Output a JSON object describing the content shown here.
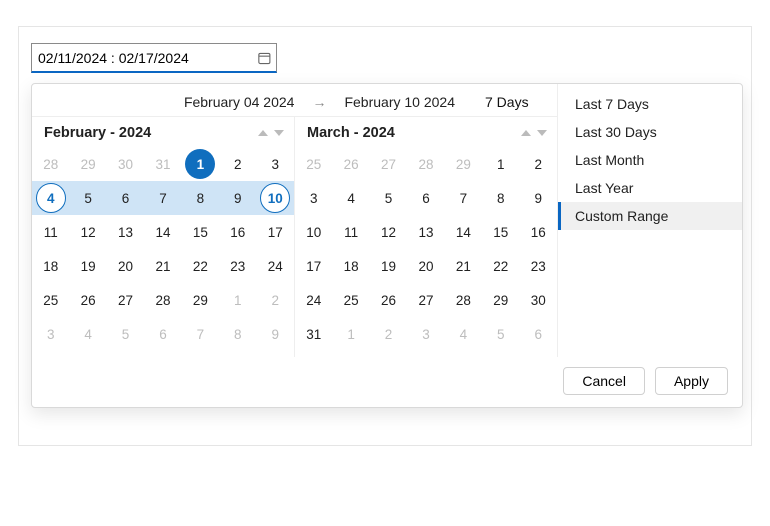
{
  "input": {
    "value": "02/11/2024 : 02/17/2024"
  },
  "summary": {
    "start": "February 04 2024",
    "end": "February 10 2024",
    "duration": "7 Days"
  },
  "months": [
    {
      "title": "February - 2024",
      "cells": [
        [
          {
            "n": "28",
            "out": true
          },
          {
            "n": "29",
            "out": true
          },
          {
            "n": "30",
            "out": true
          },
          {
            "n": "31",
            "out": true
          },
          {
            "n": "1",
            "start": true
          },
          {
            "n": "2"
          },
          {
            "n": "3"
          }
        ],
        [
          {
            "n": "4",
            "rstart": true
          },
          {
            "n": "5",
            "range": true
          },
          {
            "n": "6",
            "range": true
          },
          {
            "n": "7",
            "range": true
          },
          {
            "n": "8",
            "range": true
          },
          {
            "n": "9",
            "range": true
          },
          {
            "n": "10",
            "end": true
          }
        ],
        [
          {
            "n": "11"
          },
          {
            "n": "12"
          },
          {
            "n": "13"
          },
          {
            "n": "14"
          },
          {
            "n": "15"
          },
          {
            "n": "16"
          },
          {
            "n": "17"
          }
        ],
        [
          {
            "n": "18"
          },
          {
            "n": "19"
          },
          {
            "n": "20"
          },
          {
            "n": "21"
          },
          {
            "n": "22"
          },
          {
            "n": "23"
          },
          {
            "n": "24"
          }
        ],
        [
          {
            "n": "25"
          },
          {
            "n": "26"
          },
          {
            "n": "27"
          },
          {
            "n": "28"
          },
          {
            "n": "29"
          },
          {
            "n": "1",
            "out": true
          },
          {
            "n": "2",
            "out": true
          }
        ],
        [
          {
            "n": "3",
            "out": true
          },
          {
            "n": "4",
            "out": true
          },
          {
            "n": "5",
            "out": true
          },
          {
            "n": "6",
            "out": true
          },
          {
            "n": "7",
            "out": true
          },
          {
            "n": "8",
            "out": true
          },
          {
            "n": "9",
            "out": true
          }
        ]
      ]
    },
    {
      "title": "March - 2024",
      "cells": [
        [
          {
            "n": "25",
            "out": true
          },
          {
            "n": "26",
            "out": true
          },
          {
            "n": "27",
            "out": true
          },
          {
            "n": "28",
            "out": true
          },
          {
            "n": "29",
            "out": true
          },
          {
            "n": "1"
          },
          {
            "n": "2"
          }
        ],
        [
          {
            "n": "3"
          },
          {
            "n": "4"
          },
          {
            "n": "5"
          },
          {
            "n": "6"
          },
          {
            "n": "7"
          },
          {
            "n": "8"
          },
          {
            "n": "9"
          }
        ],
        [
          {
            "n": "10"
          },
          {
            "n": "11"
          },
          {
            "n": "12"
          },
          {
            "n": "13"
          },
          {
            "n": "14"
          },
          {
            "n": "15"
          },
          {
            "n": "16"
          }
        ],
        [
          {
            "n": "17"
          },
          {
            "n": "18"
          },
          {
            "n": "19"
          },
          {
            "n": "20"
          },
          {
            "n": "21"
          },
          {
            "n": "22"
          },
          {
            "n": "23"
          }
        ],
        [
          {
            "n": "24"
          },
          {
            "n": "25"
          },
          {
            "n": "26"
          },
          {
            "n": "27"
          },
          {
            "n": "28"
          },
          {
            "n": "29"
          },
          {
            "n": "30"
          }
        ],
        [
          {
            "n": "31"
          },
          {
            "n": "1",
            "out": true
          },
          {
            "n": "2",
            "out": true
          },
          {
            "n": "3",
            "out": true
          },
          {
            "n": "4",
            "out": true
          },
          {
            "n": "5",
            "out": true
          },
          {
            "n": "6",
            "out": true
          }
        ]
      ]
    }
  ],
  "presets": [
    {
      "label": "Last 7 Days",
      "active": false
    },
    {
      "label": "Last 30 Days",
      "active": false
    },
    {
      "label": "Last Month",
      "active": false
    },
    {
      "label": "Last Year",
      "active": false
    },
    {
      "label": "Custom Range",
      "active": true
    }
  ],
  "buttons": {
    "cancel": "Cancel",
    "apply": "Apply"
  }
}
